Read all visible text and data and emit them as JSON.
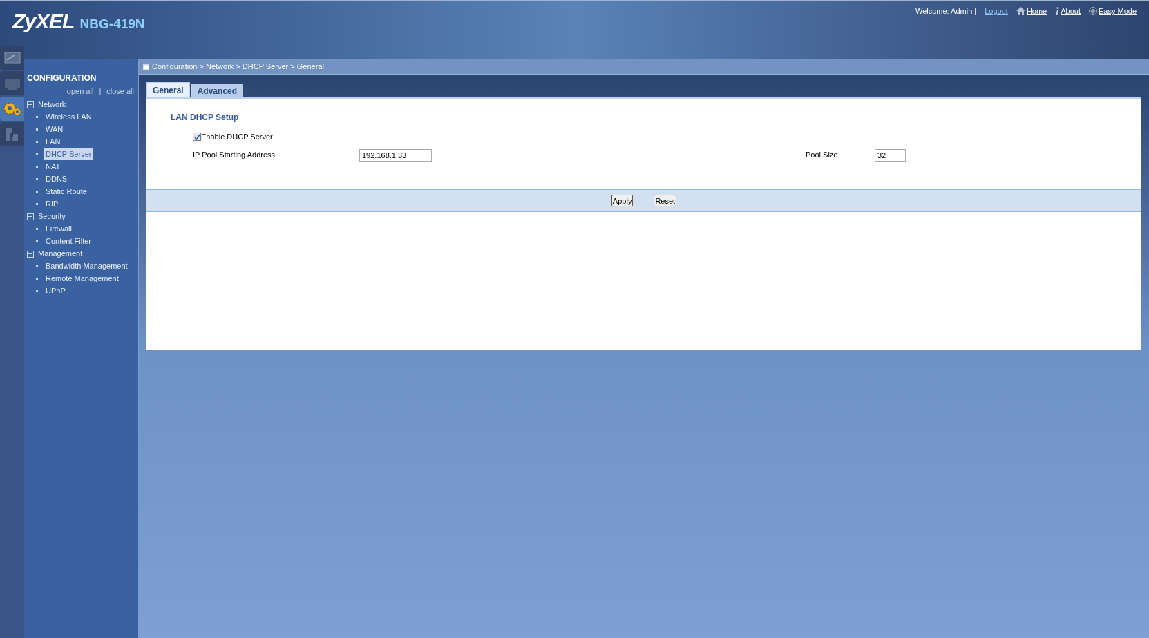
{
  "header": {
    "logo": "ZyXEL",
    "model": "NBG-419N",
    "welcome": "Welcome: Admin |",
    "links": [
      {
        "kind": "logout",
        "label": "Logout"
      },
      {
        "kind": "home",
        "label": "Home"
      },
      {
        "kind": "about",
        "label": "About"
      },
      {
        "kind": "easy",
        "label": "Easy Mode"
      }
    ]
  },
  "side_tabs": [
    {
      "kind": "monitor",
      "selected": false
    },
    {
      "kind": "screen",
      "selected": false
    },
    {
      "kind": "gears",
      "selected": true
    },
    {
      "kind": "tools",
      "selected": false
    }
  ],
  "sidebar": {
    "title": "CONFIGURATION",
    "open_all": "open all",
    "separator": "|",
    "close_all": "close all",
    "items": [
      {
        "label": "Network",
        "expanded": true,
        "children": [
          {
            "label": "Wireless LAN",
            "selected": false
          },
          {
            "label": "WAN",
            "selected": false
          },
          {
            "label": "LAN",
            "selected": false
          },
          {
            "label": "DHCP Server",
            "selected": true
          },
          {
            "label": "NAT",
            "selected": false
          },
          {
            "label": "DDNS",
            "selected": false
          },
          {
            "label": "Static Route",
            "selected": false
          },
          {
            "label": "RIP",
            "selected": false
          }
        ]
      },
      {
        "label": "Security",
        "expanded": true,
        "children": [
          {
            "label": "Firewall",
            "selected": false
          },
          {
            "label": "Content Filter",
            "selected": false
          }
        ]
      },
      {
        "label": "Management",
        "expanded": true,
        "children": [
          {
            "label": "Bandwidth Management",
            "selected": false
          },
          {
            "label": "Remote Management",
            "selected": false
          },
          {
            "label": "UPnP",
            "selected": false
          }
        ]
      }
    ]
  },
  "breadcrumb": "Configuration > Network > DHCP Server > General",
  "tabs": [
    {
      "label": "General",
      "selected": true
    },
    {
      "label": "Advanced",
      "selected": false
    }
  ],
  "form": {
    "section": "LAN DHCP Setup",
    "enable": {
      "label": "Enable DHCP Server",
      "checked": true
    },
    "start": {
      "label": "IP Pool Starting Address",
      "value": "192.168.1.33"
    },
    "size": {
      "label": "Pool Size",
      "value": "32"
    }
  },
  "buttons": [
    "Apply",
    "Reset"
  ]
}
